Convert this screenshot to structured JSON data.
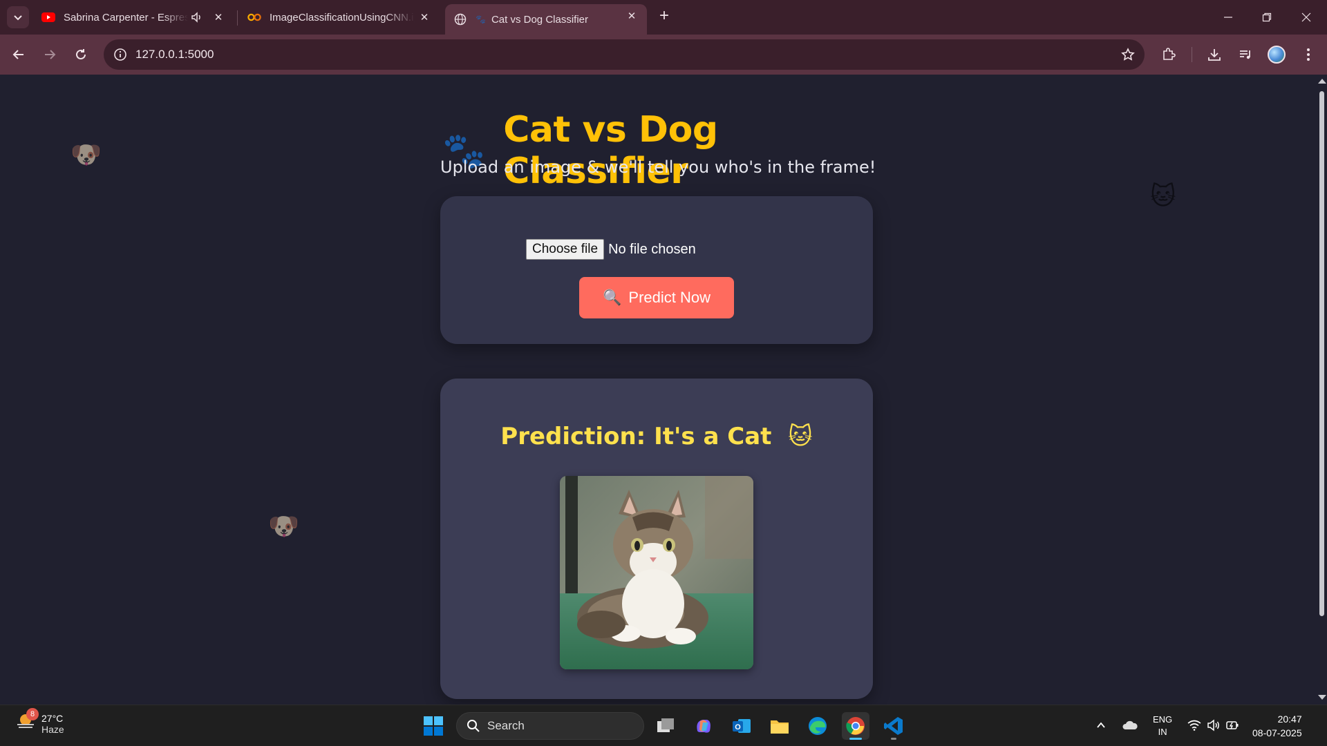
{
  "browser": {
    "tabs": [
      {
        "title": "Sabrina Carpenter - Espresso",
        "icon": "youtube-icon",
        "audio": true
      },
      {
        "title": "ImageClassificationUsingCNN.ipynb",
        "icon": "colab-icon"
      },
      {
        "title": "Cat vs Dog Classifier",
        "icon": "globe-icon",
        "active": true
      }
    ],
    "url": "127.0.0.1:5000"
  },
  "page": {
    "title": "Cat vs Dog Classifier",
    "title_emoji": "🐾",
    "subtitle": "Upload an image & we'll tell you who's in the frame!",
    "file_button": "Choose file",
    "file_status": "No file chosen",
    "predict_emoji": "🔍",
    "predict_label": "Predict Now",
    "prediction_text": "Prediction: It's a Cat",
    "prediction_emoji": "🐱",
    "floaters": [
      "🐶",
      "🐱",
      "🐶"
    ]
  },
  "taskbar": {
    "weather_temp": "27°C",
    "weather_cond": "Haze",
    "weather_badge": "8",
    "search_placeholder": "Search",
    "lang_line1": "ENG",
    "lang_line2": "IN",
    "time": "20:47",
    "date": "08-07-2025"
  },
  "colors": {
    "accent_title": "#ffc107",
    "prediction": "#ffe14d",
    "predict_button": "#ff6b5e"
  }
}
